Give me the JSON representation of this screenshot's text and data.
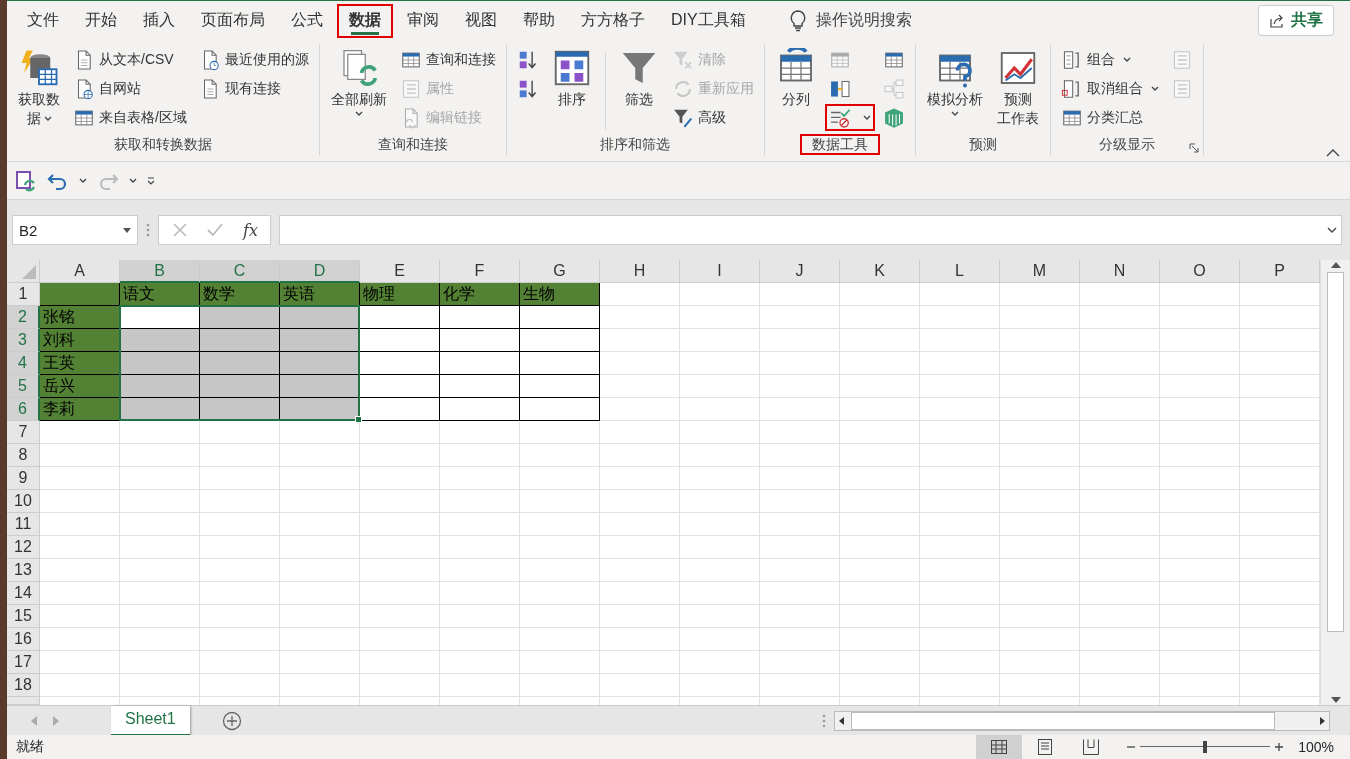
{
  "tabs": [
    {
      "label": "文件",
      "selected": false,
      "outlined": false
    },
    {
      "label": "开始",
      "selected": false,
      "outlined": false
    },
    {
      "label": "插入",
      "selected": false,
      "outlined": false
    },
    {
      "label": "页面布局",
      "selected": false,
      "outlined": false
    },
    {
      "label": "公式",
      "selected": false,
      "outlined": false
    },
    {
      "label": "数据",
      "selected": true,
      "outlined": true
    },
    {
      "label": "审阅",
      "selected": false,
      "outlined": false
    },
    {
      "label": "视图",
      "selected": false,
      "outlined": false
    },
    {
      "label": "帮助",
      "selected": false,
      "outlined": false
    },
    {
      "label": "方方格子",
      "selected": false,
      "outlined": false
    },
    {
      "label": "DIY工具箱",
      "selected": false,
      "outlined": false
    }
  ],
  "tell_me": {
    "label": "操作说明搜索"
  },
  "share_button": {
    "label": "共享"
  },
  "ribbon": {
    "groups": [
      {
        "label": "获取和转换数据",
        "outlined": false,
        "launcher": false,
        "items": [
          {
            "kind": "large",
            "lines": [
              "获取数",
              "据"
            ],
            "dropdown": true,
            "disabled": false,
            "outlined": false
          },
          {
            "kind": "stack",
            "entries": [
              {
                "label": "从文本/CSV",
                "dropdown": false,
                "disabled": false,
                "outlined": false
              },
              {
                "label": "自网站",
                "dropdown": false,
                "disabled": false,
                "outlined": false
              },
              {
                "label": "来自表格/区域",
                "dropdown": false,
                "disabled": false,
                "outlined": false
              }
            ]
          },
          {
            "kind": "stack",
            "entries": [
              {
                "label": "最近使用的源",
                "dropdown": false,
                "disabled": false,
                "outlined": false
              },
              {
                "label": "现有连接",
                "dropdown": false,
                "disabled": false,
                "outlined": false
              }
            ]
          }
        ]
      },
      {
        "label": "查询和连接",
        "outlined": false,
        "launcher": false,
        "items": [
          {
            "kind": "large",
            "lines": [
              "全部刷新"
            ],
            "dropdown": true,
            "disabled": false,
            "outlined": false
          },
          {
            "kind": "stack",
            "entries": [
              {
                "label": "查询和连接",
                "dropdown": false,
                "disabled": false,
                "outlined": false
              },
              {
                "label": "属性",
                "dropdown": false,
                "disabled": true,
                "outlined": false
              },
              {
                "label": "编辑链接",
                "dropdown": false,
                "disabled": true,
                "outlined": false
              }
            ]
          }
        ]
      },
      {
        "label": "排序和筛选",
        "outlined": false,
        "launcher": false,
        "items": [
          {
            "kind": "stack",
            "entries": [
              {
                "dropdown": false,
                "disabled": false,
                "outlined": false
              },
              {
                "dropdown": false,
                "disabled": false,
                "outlined": false
              }
            ]
          },
          {
            "kind": "large",
            "lines": [
              "排序"
            ],
            "dropdown": false,
            "disabled": false,
            "outlined": false
          },
          {
            "kind": "separator"
          },
          {
            "kind": "large",
            "lines": [
              "筛选"
            ],
            "dropdown": false,
            "disabled": false,
            "outlined": false
          },
          {
            "kind": "stack",
            "entries": [
              {
                "label": "清除",
                "dropdown": false,
                "disabled": true,
                "outlined": false
              },
              {
                "label": "重新应用",
                "dropdown": false,
                "disabled": true,
                "outlined": false
              },
              {
                "label": "高级",
                "dropdown": false,
                "disabled": false,
                "outlined": false
              }
            ]
          }
        ]
      },
      {
        "label": "数据工具",
        "outlined": true,
        "launcher": false,
        "items": [
          {
            "kind": "large",
            "lines": [
              "分列"
            ],
            "dropdown": false,
            "disabled": false,
            "outlined": false
          },
          {
            "kind": "stack",
            "entries": [
              {
                "dropdown": false,
                "disabled": true,
                "outlined": false
              },
              {
                "dropdown": false,
                "disabled": false,
                "outlined": false
              },
              {
                "dropdown": true,
                "disabled": false,
                "outlined": true
              }
            ]
          },
          {
            "kind": "stack",
            "entries": [
              {
                "dropdown": false,
                "disabled": false,
                "outlined": false
              },
              {
                "dropdown": false,
                "disabled": true,
                "outlined": false
              },
              {
                "dropdown": false,
                "disabled": false,
                "outlined": false
              }
            ]
          }
        ]
      },
      {
        "label": "预测",
        "outlined": false,
        "launcher": false,
        "items": [
          {
            "kind": "large",
            "lines": [
              "模拟分析"
            ],
            "dropdown": true,
            "disabled": false,
            "outlined": false
          },
          {
            "kind": "large",
            "lines": [
              "预测",
              "工作表"
            ],
            "dropdown": false,
            "disabled": false,
            "outlined": false
          }
        ]
      },
      {
        "label": "分级显示",
        "outlined": false,
        "launcher": true,
        "items": [
          {
            "kind": "stack",
            "entries": [
              {
                "label": "组合",
                "dropdown": true,
                "disabled": false,
                "outlined": false
              },
              {
                "label": "取消组合",
                "dropdown": true,
                "disabled": false,
                "outlined": false
              },
              {
                "label": "分类汇总",
                "dropdown": false,
                "disabled": false,
                "outlined": false
              }
            ]
          },
          {
            "kind": "stack",
            "entries": [
              {
                "dropdown": false,
                "disabled": true,
                "outlined": false
              },
              {
                "dropdown": false,
                "disabled": true,
                "outlined": false
              }
            ]
          }
        ]
      }
    ]
  },
  "name_box": {
    "value": "B2"
  },
  "formula_bar": {
    "fx": "fx"
  },
  "sheet": {
    "columns": [
      {
        "label": "A",
        "selected": false
      },
      {
        "label": "B",
        "selected": true
      },
      {
        "label": "C",
        "selected": true
      },
      {
        "label": "D",
        "selected": true
      },
      {
        "label": "E",
        "selected": false
      },
      {
        "label": "F",
        "selected": false
      },
      {
        "label": "G",
        "selected": false
      },
      {
        "label": "H",
        "selected": false
      },
      {
        "label": "I",
        "selected": false
      },
      {
        "label": "J",
        "selected": false
      },
      {
        "label": "K",
        "selected": false
      },
      {
        "label": "L",
        "selected": false
      },
      {
        "label": "M",
        "selected": false
      },
      {
        "label": "N",
        "selected": false
      },
      {
        "label": "O",
        "selected": false
      },
      {
        "label": "P",
        "selected": false
      }
    ],
    "rows": [
      {
        "label": "1",
        "selected": false,
        "cells": [
          {
            "kind": "header"
          },
          {
            "kind": "header",
            "text": "语文"
          },
          {
            "kind": "header",
            "text": "数学"
          },
          {
            "kind": "header",
            "text": "英语"
          },
          {
            "kind": "header",
            "text": "物理"
          },
          {
            "kind": "header",
            "text": "化学"
          },
          {
            "kind": "header",
            "text": "生物"
          }
        ]
      },
      {
        "label": "2",
        "selected": true,
        "cells": [
          {
            "kind": "header",
            "text": "张铭"
          },
          {
            "kind": "active"
          },
          {
            "kind": "selected"
          },
          {
            "kind": "selected"
          },
          {
            "kind": "bordered"
          },
          {
            "kind": "bordered"
          },
          {
            "kind": "bordered"
          }
        ]
      },
      {
        "label": "3",
        "selected": true,
        "cells": [
          {
            "kind": "header",
            "text": "刘科"
          },
          {
            "kind": "selected"
          },
          {
            "kind": "selected"
          },
          {
            "kind": "selected"
          },
          {
            "kind": "bordered"
          },
          {
            "kind": "bordered"
          },
          {
            "kind": "bordered"
          }
        ]
      },
      {
        "label": "4",
        "selected": true,
        "cells": [
          {
            "kind": "header",
            "text": "王英"
          },
          {
            "kind": "selected"
          },
          {
            "kind": "selected"
          },
          {
            "kind": "selected"
          },
          {
            "kind": "bordered"
          },
          {
            "kind": "bordered"
          },
          {
            "kind": "bordered"
          }
        ]
      },
      {
        "label": "5",
        "selected": true,
        "cells": [
          {
            "kind": "header",
            "text": "岳兴"
          },
          {
            "kind": "selected"
          },
          {
            "kind": "selected"
          },
          {
            "kind": "selected"
          },
          {
            "kind": "bordered"
          },
          {
            "kind": "bordered"
          },
          {
            "kind": "bordered"
          }
        ]
      },
      {
        "label": "6",
        "selected": true,
        "cells": [
          {
            "kind": "header",
            "text": "李莉"
          },
          {
            "kind": "selected"
          },
          {
            "kind": "selected"
          },
          {
            "kind": "selected"
          },
          {
            "kind": "bordered"
          },
          {
            "kind": "bordered"
          },
          {
            "kind": "bordered"
          }
        ]
      },
      {
        "label": "7",
        "selected": false
      },
      {
        "label": "8",
        "selected": false
      },
      {
        "label": "9",
        "selected": false
      },
      {
        "label": "10",
        "selected": false
      },
      {
        "label": "11",
        "selected": false
      },
      {
        "label": "12",
        "selected": false
      },
      {
        "label": "13",
        "selected": false
      },
      {
        "label": "14",
        "selected": false
      },
      {
        "label": "15",
        "selected": false
      },
      {
        "label": "16",
        "selected": false
      },
      {
        "label": "17",
        "selected": false
      },
      {
        "label": "18",
        "selected": false
      }
    ]
  },
  "sheet_tabs": [
    {
      "label": "Sheet1",
      "selected": true
    }
  ],
  "status_bar": {
    "text": "就绪",
    "zoom": {
      "level": 0.5,
      "reading": "100%"
    }
  }
}
